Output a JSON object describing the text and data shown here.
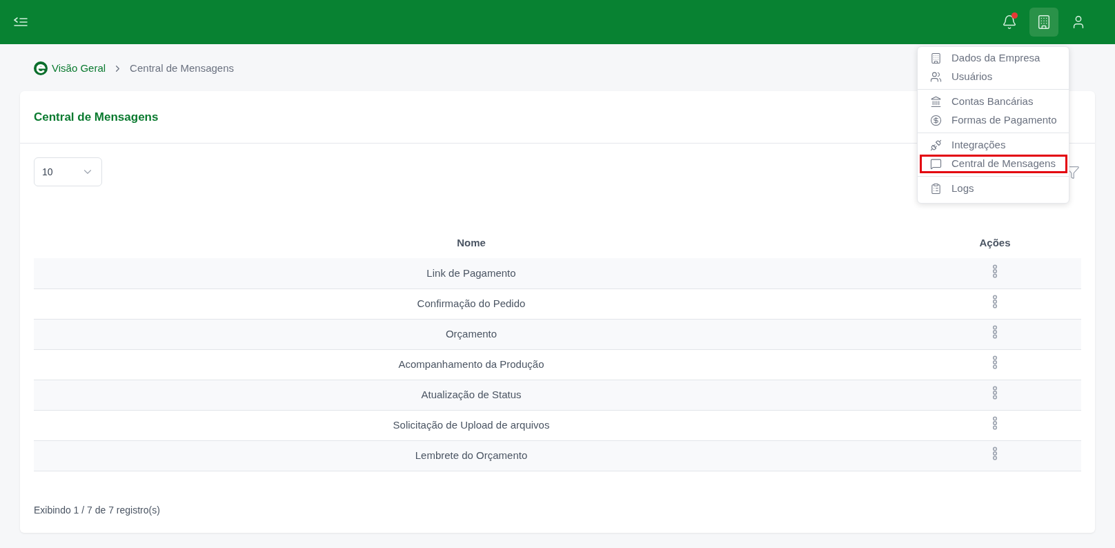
{
  "header": {
    "buttons": [
      {
        "kind": "bell",
        "badge": true,
        "active": false
      },
      {
        "kind": "company",
        "badge": false,
        "active": true
      },
      {
        "kind": "user",
        "badge": false,
        "active": false
      }
    ]
  },
  "breadcrumb": [
    {
      "label": "Visão Geral",
      "link": true
    },
    {
      "label": "Central de Mensagens",
      "link": false
    }
  ],
  "card": {
    "title": "Central de Mensagens"
  },
  "page_size": {
    "value": "10"
  },
  "table": {
    "columns": [
      "Nome",
      "Ações"
    ],
    "rows": [
      {
        "name": "Link de Pagamento"
      },
      {
        "name": "Confirmação do Pedido"
      },
      {
        "name": "Orçamento"
      },
      {
        "name": "Acompanhamento da Produção"
      },
      {
        "name": "Atualização de Status"
      },
      {
        "name": "Solicitação de Upload de arquivos"
      },
      {
        "name": "Lembrete do Orçamento"
      }
    ]
  },
  "footer": "Exibindo 1 / 7 de 7 registro(s)",
  "menu": {
    "groups": [
      [
        {
          "kind": "building",
          "label": "Dados da Empresa",
          "selected": false
        },
        {
          "kind": "users",
          "label": "Usuários",
          "selected": false
        }
      ],
      [
        {
          "kind": "bank",
          "label": "Contas Bancárias",
          "selected": false
        },
        {
          "kind": "money",
          "label": "Formas de Pagamento",
          "selected": false
        }
      ],
      [
        {
          "kind": "plug",
          "label": "Integrações",
          "selected": false
        },
        {
          "kind": "message",
          "label": "Central de Mensagens",
          "selected": true
        }
      ],
      [
        {
          "kind": "logs",
          "label": "Logs",
          "selected": false
        }
      ]
    ]
  }
}
